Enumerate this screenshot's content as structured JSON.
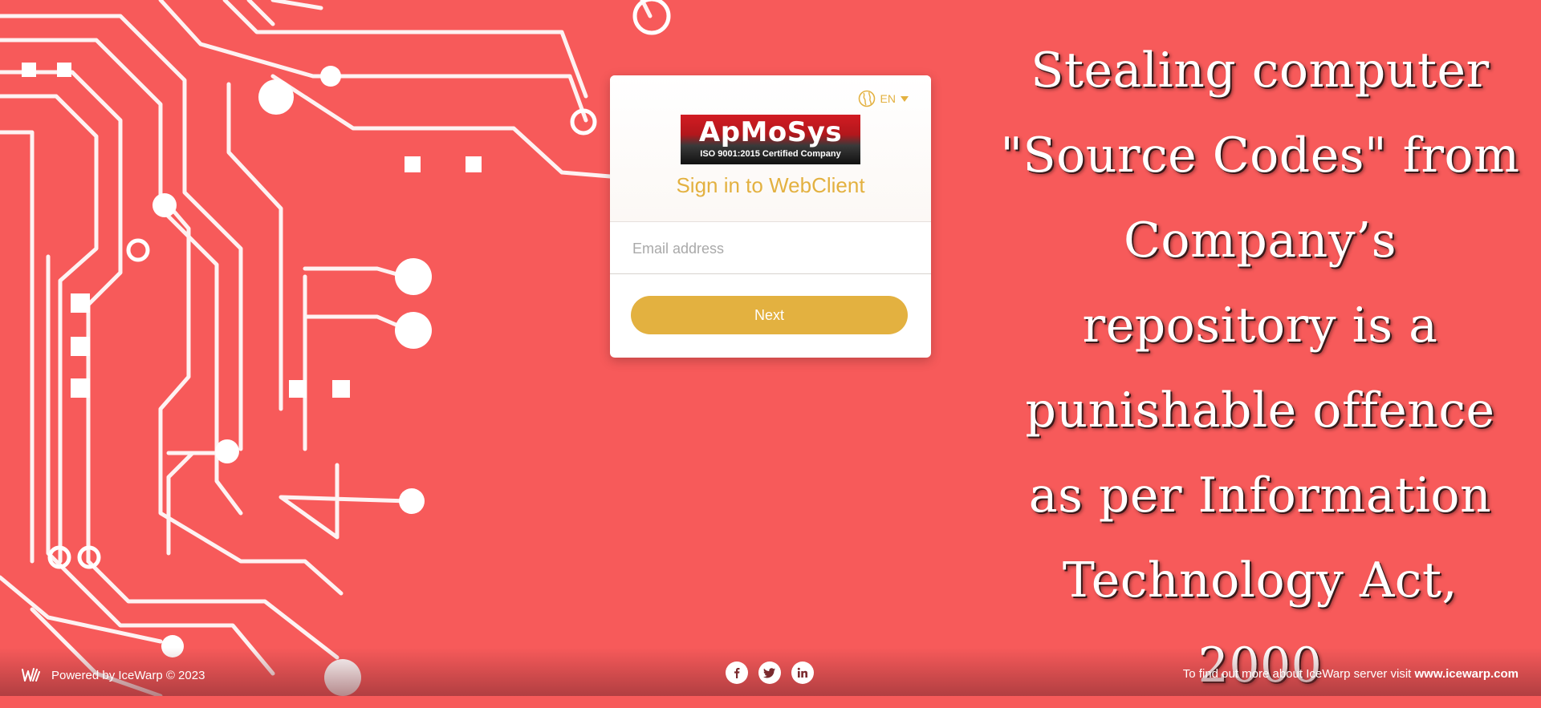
{
  "notice": {
    "lines": [
      "Stealing computer",
      "\"Source Codes\" from",
      "Company’s",
      "repository is a",
      "punishable offence",
      "as per Information",
      "Technology Act,",
      "2000"
    ]
  },
  "login": {
    "language": "EN",
    "logo": {
      "brand": "ApMoSys",
      "cert": "ISO 9001:2015 Certified Company"
    },
    "title": "Sign in to WebClient",
    "email_placeholder": "Email address",
    "email_value": "",
    "next_label": "Next"
  },
  "footer": {
    "powered_by": "Powered by IceWarp © 2023",
    "info_text": "To find out more about IceWarp server visit ",
    "info_link": "www.icewarp.com",
    "social": [
      "facebook-icon",
      "twitter-icon",
      "linkedin-icon"
    ]
  },
  "colors": {
    "background": "#f75a5a",
    "accent": "#e3b140",
    "logo_red": "#d21b22"
  }
}
